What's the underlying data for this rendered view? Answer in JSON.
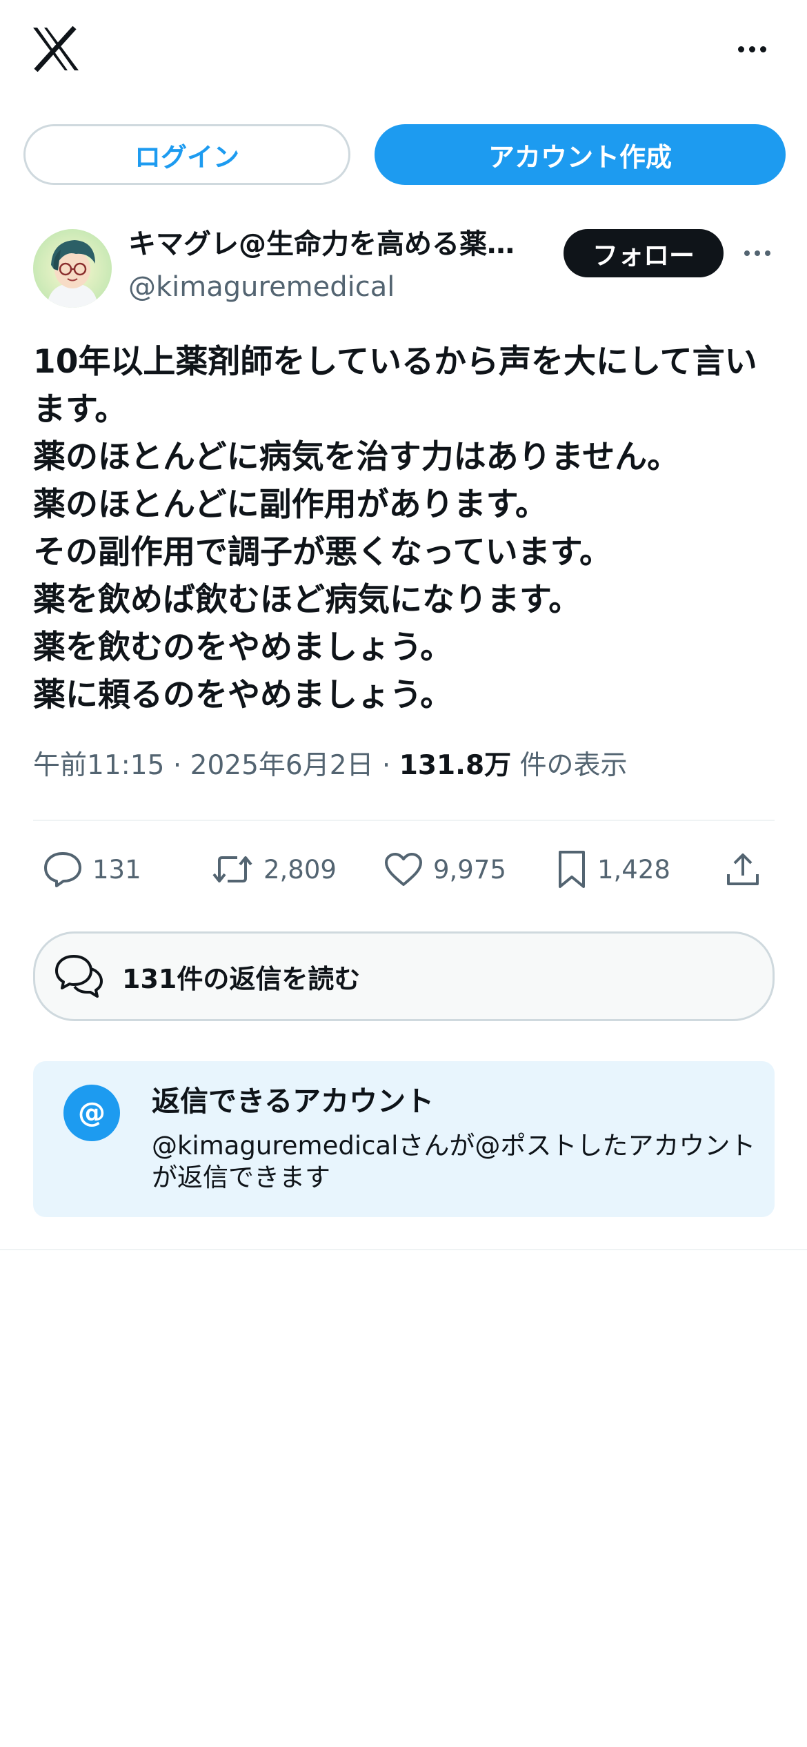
{
  "topbar": {
    "logo_icon": "x-logo-icon",
    "more_icon": "more-horizontal-icon"
  },
  "auth": {
    "login_label": "ログイン",
    "signup_label": "アカウント作成"
  },
  "author": {
    "display_name": "キマグレ@生命力を高める薬…",
    "handle": "@kimaguremedical",
    "follow_label": "フォロー"
  },
  "post": {
    "lines": [
      "10年以上薬剤師をしているから声を大にして言い",
      "ます。",
      "薬のほとんどに病気を治す力はありません。",
      "薬のほとんどに副作用があります。",
      "その副作用で調子が悪くなっています。",
      "薬を飲めば飲むほど病気になります。",
      "薬を飲むのをやめましょう。",
      "薬に頼るのをやめましょう。"
    ],
    "time": "午前11:15",
    "sep": "·",
    "date": "2025年6月2日",
    "views": "131.8万",
    "views_label": "件の表示"
  },
  "actions": {
    "replies": "131",
    "reposts": "2,809",
    "likes": "9,975",
    "bookmarks": "1,428"
  },
  "read_replies": {
    "label": "131件の返信を読む"
  },
  "who_can_reply": {
    "title": "返信できるアカウント",
    "description": "@kimaguremedicalさんが@ポストしたアカウントが返信できます",
    "at_symbol": "@"
  },
  "colors": {
    "accent": "#1d9bf0",
    "text": "#0f1419",
    "muted": "#536471",
    "border": "#cfd9de",
    "info_bg": "#e8f5fd"
  }
}
